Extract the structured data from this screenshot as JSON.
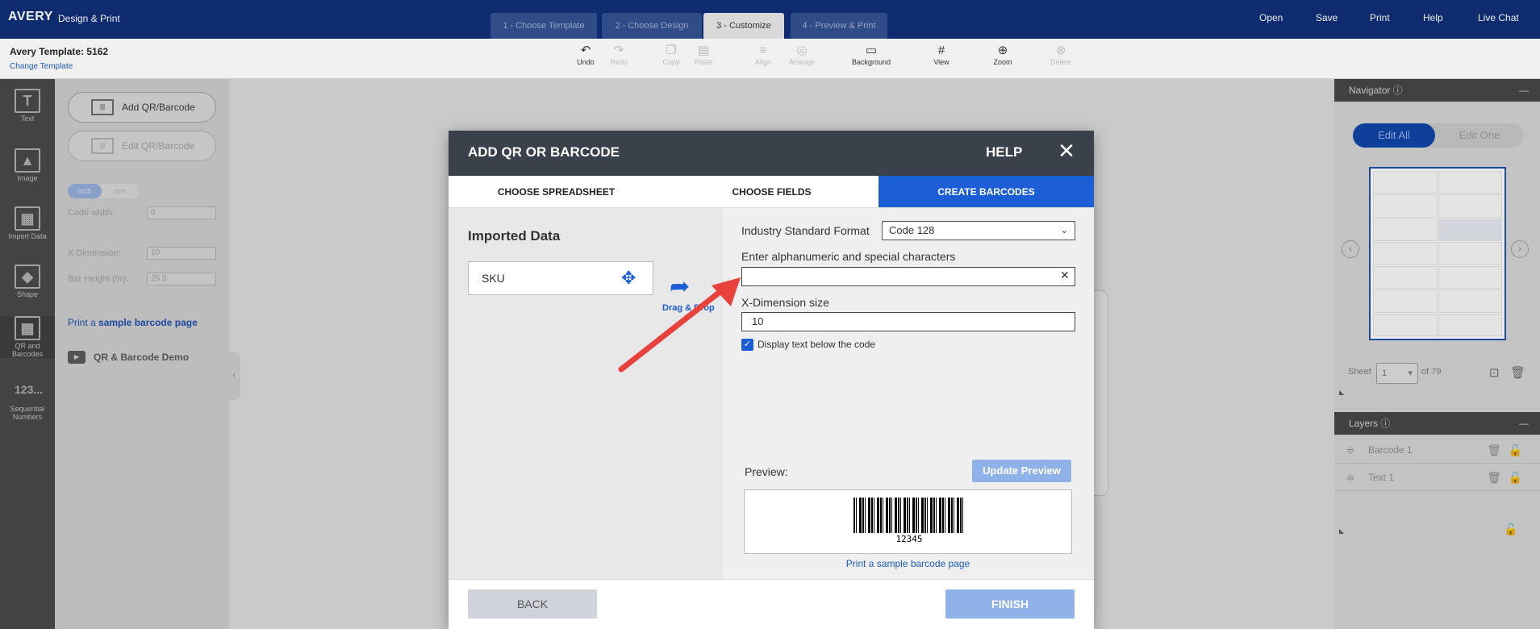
{
  "brand": {
    "logo": "AVERY",
    "subtitle": "Design & Print"
  },
  "steps": [
    {
      "label": "1 - Choose Template"
    },
    {
      "label": "2 - Choose Design"
    },
    {
      "label": "3 - Customize"
    },
    {
      "label": "4 - Preview & Print"
    }
  ],
  "top_nav": [
    "Open",
    "Save",
    "Print",
    "Help",
    "Live Chat"
  ],
  "template": {
    "title": "Avery Template: 5162",
    "change_link": "Change Template"
  },
  "toolbar": {
    "undo": "Undo",
    "redo": "Redo",
    "copy": "Copy",
    "paste": "Paste",
    "align": "Align",
    "arrange": "Arrange",
    "background": "Background",
    "view": "View",
    "zoom": "Zoom",
    "delete": "Delete"
  },
  "rail": [
    {
      "label": "Text",
      "glyph": "T"
    },
    {
      "label": "Image",
      "glyph": "▲"
    },
    {
      "label": "Import Data",
      "glyph": "▦"
    },
    {
      "label": "Shape",
      "glyph": "◆"
    },
    {
      "label": "QR and Barcodes",
      "glyph": "▩"
    },
    {
      "label": "Sequential Numbers",
      "glyph": "123..."
    }
  ],
  "left_panel": {
    "add_btn": "Add QR/Barcode",
    "edit_btn": "Edit QR/Barcode",
    "unit_inch": "inch",
    "unit_mm": "mm",
    "code_width_label": "Code width:",
    "code_width_value": "0",
    "xdim_label": "X Dimension:",
    "xdim_value": "10",
    "bar_height_label": "Bar Height (%):",
    "bar_height_value": "25.5",
    "print_prefix": "Print a",
    "print_link": "sample barcode page",
    "demo": "QR & Barcode Demo"
  },
  "navigator": {
    "title": "Navigator",
    "edit_all": "Edit All",
    "edit_one": "Edit One",
    "sheet_label": "Sheet",
    "sheet_value": "1",
    "sheet_of": "of 79"
  },
  "layers": {
    "title": "Layers",
    "items": [
      "Barcode 1",
      "Text 1"
    ]
  },
  "modal": {
    "title": "ADD QR OR BARCODE",
    "help": "HELP",
    "close": "✕",
    "tabs": [
      "CHOOSE SPREADSHEET",
      "CHOOSE FIELDS",
      "CREATE BARCODES"
    ],
    "imported_title": "Imported Data",
    "field_sku": "SKU",
    "drag_drop": "Drag & Drop",
    "format_label": "Industry Standard Format",
    "format_value": "Code 128",
    "alnum_label": "Enter alphanumeric and special characters",
    "alnum_value": "",
    "xdim_label": "X-Dimension size",
    "xdim_value": "10",
    "display_text_label": "Display text below the code",
    "display_text_checked": true,
    "preview_label": "Preview:",
    "update_preview": "Update Preview",
    "preview_code": "12345",
    "print_sample": "Print a sample barcode page",
    "back": "BACK",
    "finish": "FINISH"
  },
  "colors": {
    "topbar": "#0a2a74",
    "accent": "#1a5dd4",
    "arrow": "#e8413c"
  }
}
